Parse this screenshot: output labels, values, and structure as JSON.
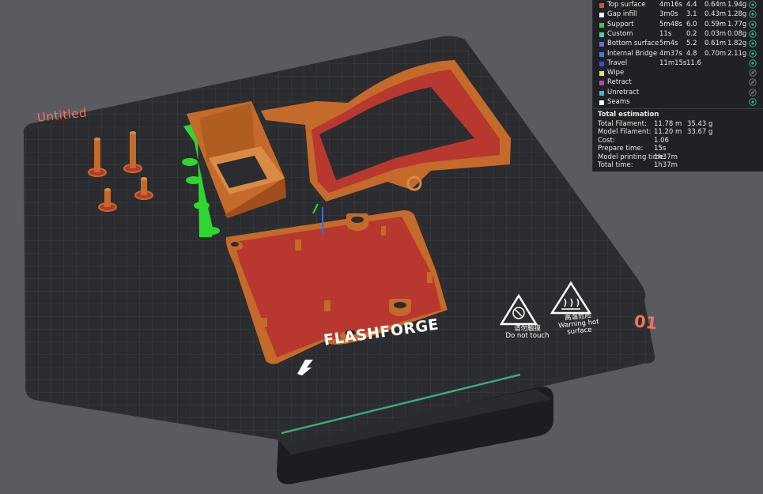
{
  "legend": {
    "rows": [
      {
        "name": "Top surface",
        "time": "4m16s",
        "percent": "4.4",
        "length": "0.64m",
        "weight": "1.94g",
        "color": "#e04a3b",
        "visible": true
      },
      {
        "name": "Gap infill",
        "time": "3m0s",
        "percent": "3.1",
        "length": "0.43m",
        "weight": "1.28g",
        "color": "#ffffff",
        "visible": true
      },
      {
        "name": "Support",
        "time": "5m48s",
        "percent": "6.0",
        "length": "0.59m",
        "weight": "1.77g",
        "color": "#2fd62f",
        "visible": true
      },
      {
        "name": "Custom",
        "time": "11s",
        "percent": "0.2",
        "length": "0.03m",
        "weight": "0.08g",
        "color": "#4fd1a6",
        "visible": true
      },
      {
        "name": "Bottom surface",
        "time": "5m4s",
        "percent": "5.2",
        "length": "0.61m",
        "weight": "1.82g",
        "color": "#6a6ad8",
        "visible": true
      },
      {
        "name": "Internal Bridge",
        "time": "4m37s",
        "percent": "4.8",
        "length": "0.70m",
        "weight": "2.11g",
        "color": "#3f7fd0",
        "visible": true
      },
      {
        "name": "Travel",
        "time": "11m15s",
        "percent": "11.6",
        "length": "",
        "weight": "",
        "color": "#3b4fd0",
        "visible": true
      },
      {
        "name": "Wipe",
        "time": "",
        "percent": "",
        "length": "",
        "weight": "",
        "color": "#e8e83a",
        "visible": false
      },
      {
        "name": "Retract",
        "time": "",
        "percent": "",
        "length": "",
        "weight": "",
        "color": "#c23ac2",
        "visible": false
      },
      {
        "name": "Unretract",
        "time": "",
        "percent": "",
        "length": "",
        "weight": "",
        "color": "#3ab8d8",
        "visible": false
      },
      {
        "name": "Seams",
        "time": "",
        "percent": "",
        "length": "",
        "weight": "",
        "color": "#ffffff",
        "visible": true
      }
    ]
  },
  "estimation": {
    "title": "Total estimation",
    "rows": [
      {
        "label": "Total Filament:",
        "value": "11.78 m",
        "value2": "35.43 g"
      },
      {
        "label": "Model Filament:",
        "value": "11.20 m",
        "value2": "33.67 g"
      },
      {
        "label": "Cost:",
        "value": "1.06",
        "value2": ""
      },
      {
        "label": "Prepare time:",
        "value": "15s",
        "value2": ""
      },
      {
        "label": "Model printing time:",
        "value": "1h37m",
        "value2": ""
      },
      {
        "label": "Total time:",
        "value": "1h37m",
        "value2": ""
      }
    ]
  },
  "bed": {
    "plate_name": "Untitled",
    "plate_number": "01",
    "brand": "FLASHFORGE",
    "warning_touch": {
      "cn": "请勿触摸",
      "en": "Do not touch"
    },
    "warning_hot": {
      "cn": "高温危险",
      "en1": "Warning hot",
      "en2": "surface"
    }
  },
  "colors": {
    "panel_bg": "#1f2124",
    "bed": "#2b2c30",
    "model_orange": "#c46a2a",
    "top_surface": "#b8372f",
    "accent_green": "#3fa87a",
    "eye_icon": "#2fb08a"
  }
}
